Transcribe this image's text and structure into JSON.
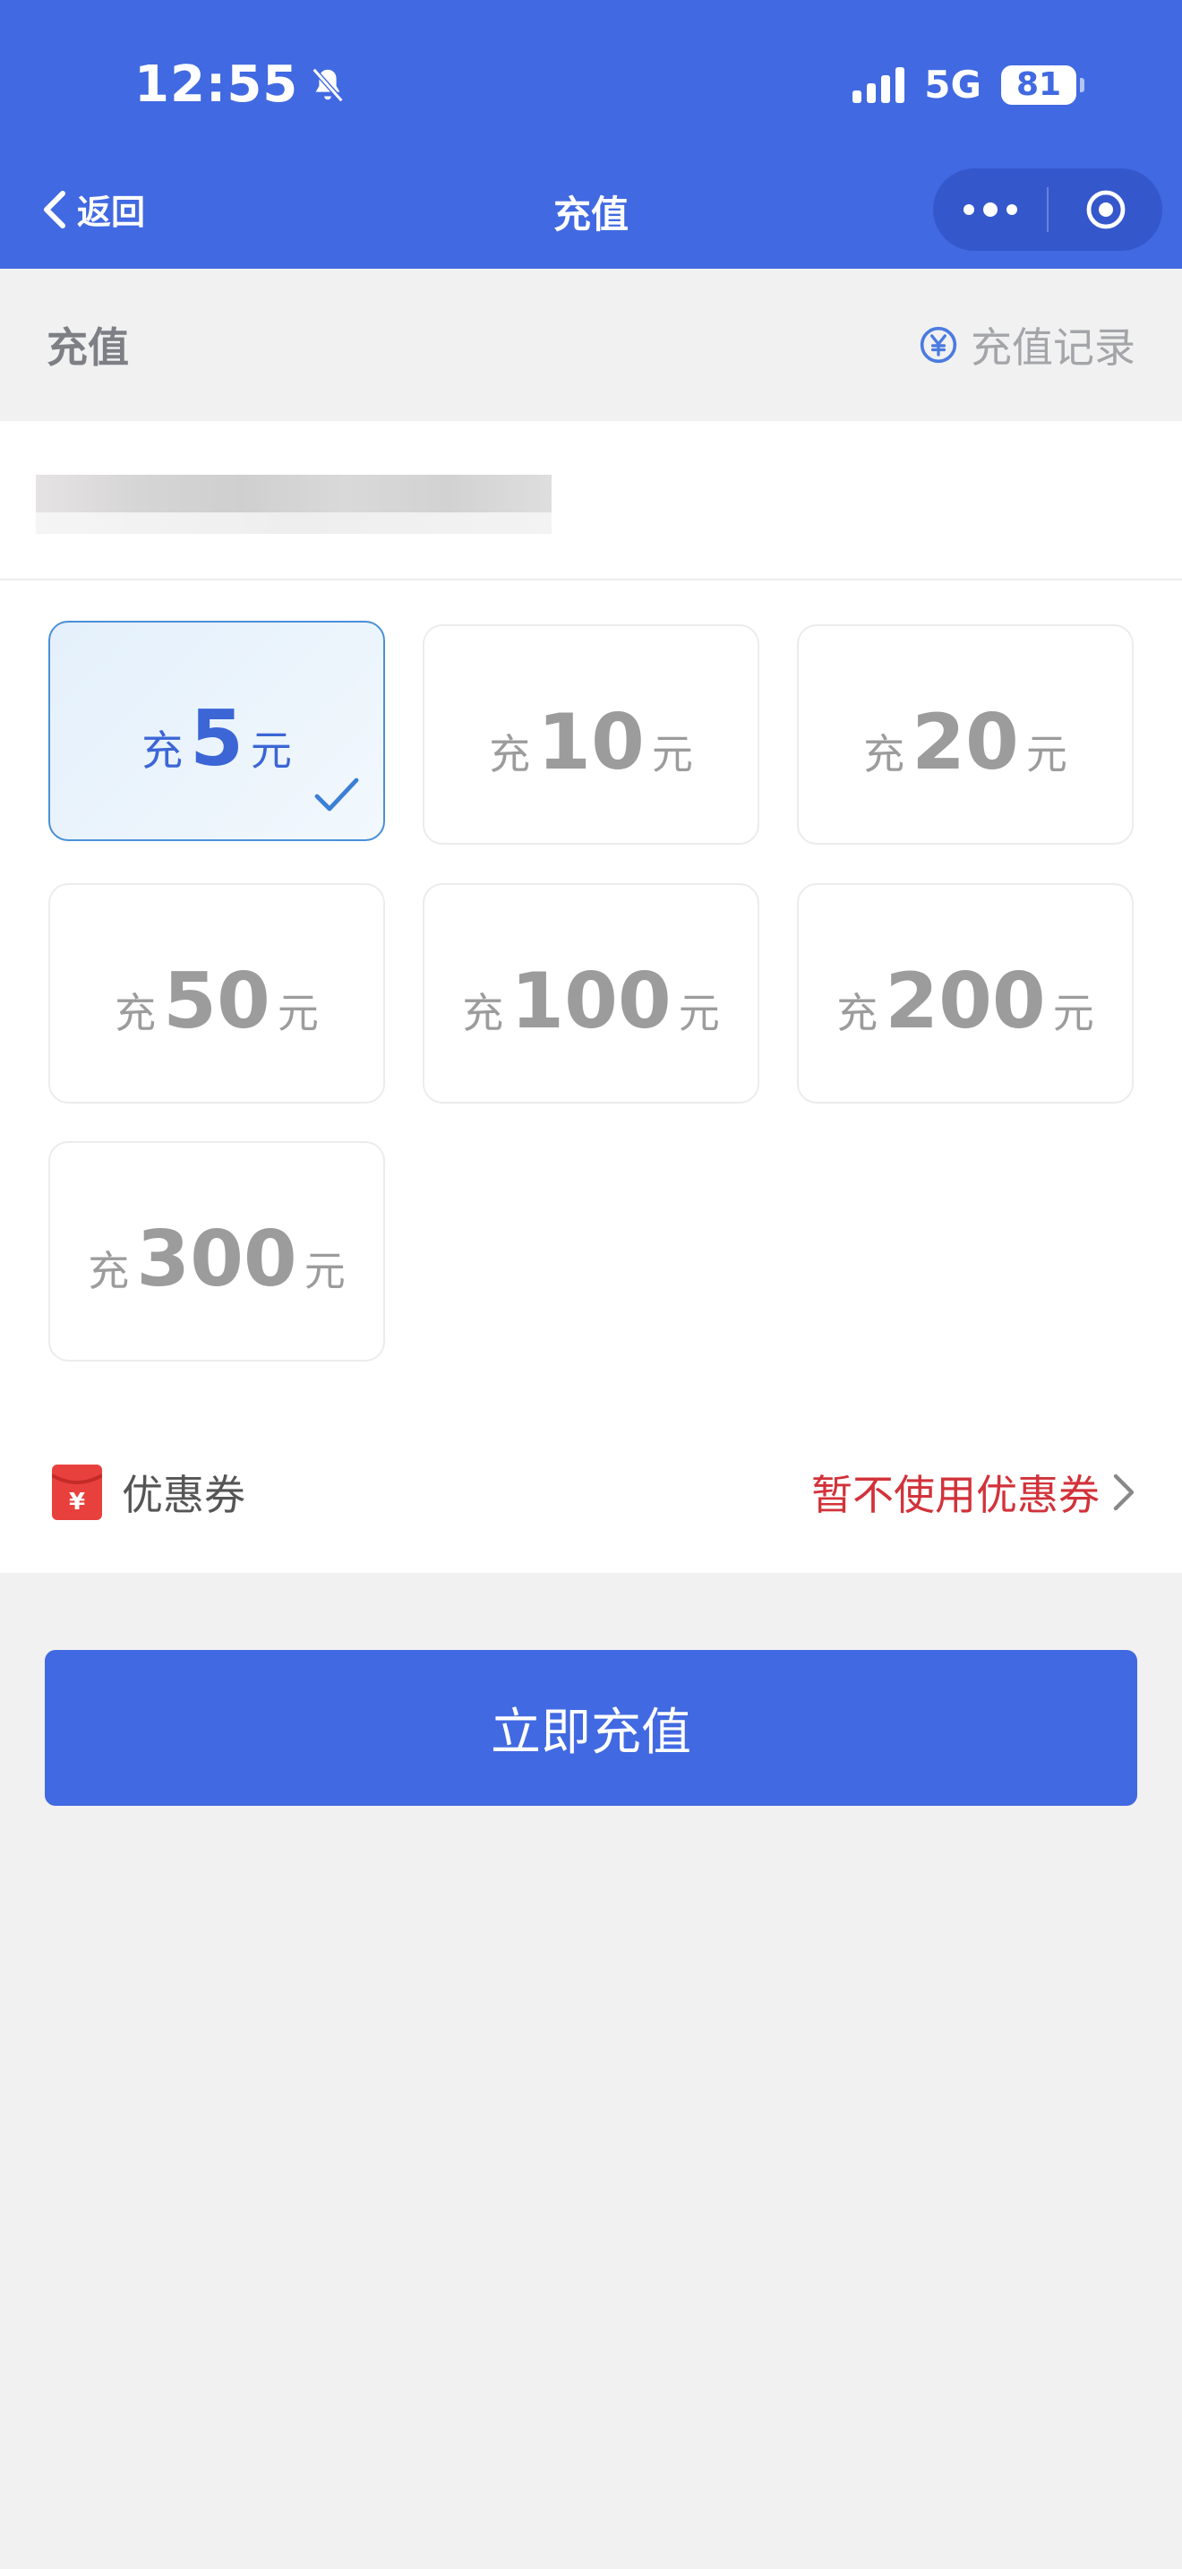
{
  "status_bar": {
    "time": "12:55",
    "network": "5G",
    "battery": "81"
  },
  "nav": {
    "back_label": "返回",
    "title": "充值"
  },
  "section": {
    "title": "充值",
    "record_label": "充值记录"
  },
  "options": [
    {
      "prefix": "充",
      "amount": "5",
      "suffix": "元",
      "selected": true
    },
    {
      "prefix": "充",
      "amount": "10",
      "suffix": "元",
      "selected": false
    },
    {
      "prefix": "充",
      "amount": "20",
      "suffix": "元",
      "selected": false
    },
    {
      "prefix": "充",
      "amount": "50",
      "suffix": "元",
      "selected": false
    },
    {
      "prefix": "充",
      "amount": "100",
      "suffix": "元",
      "selected": false
    },
    {
      "prefix": "充",
      "amount": "200",
      "suffix": "元",
      "selected": false
    },
    {
      "prefix": "充",
      "amount": "300",
      "suffix": "元",
      "selected": false
    }
  ],
  "coupon": {
    "label": "优惠券",
    "value": "暂不使用优惠券"
  },
  "submit_label": "立即充值",
  "colors": {
    "primary": "#4169e1",
    "selected_border": "#4a8fd8",
    "coupon_red": "#d2323a",
    "background": "#f1f1f2"
  }
}
